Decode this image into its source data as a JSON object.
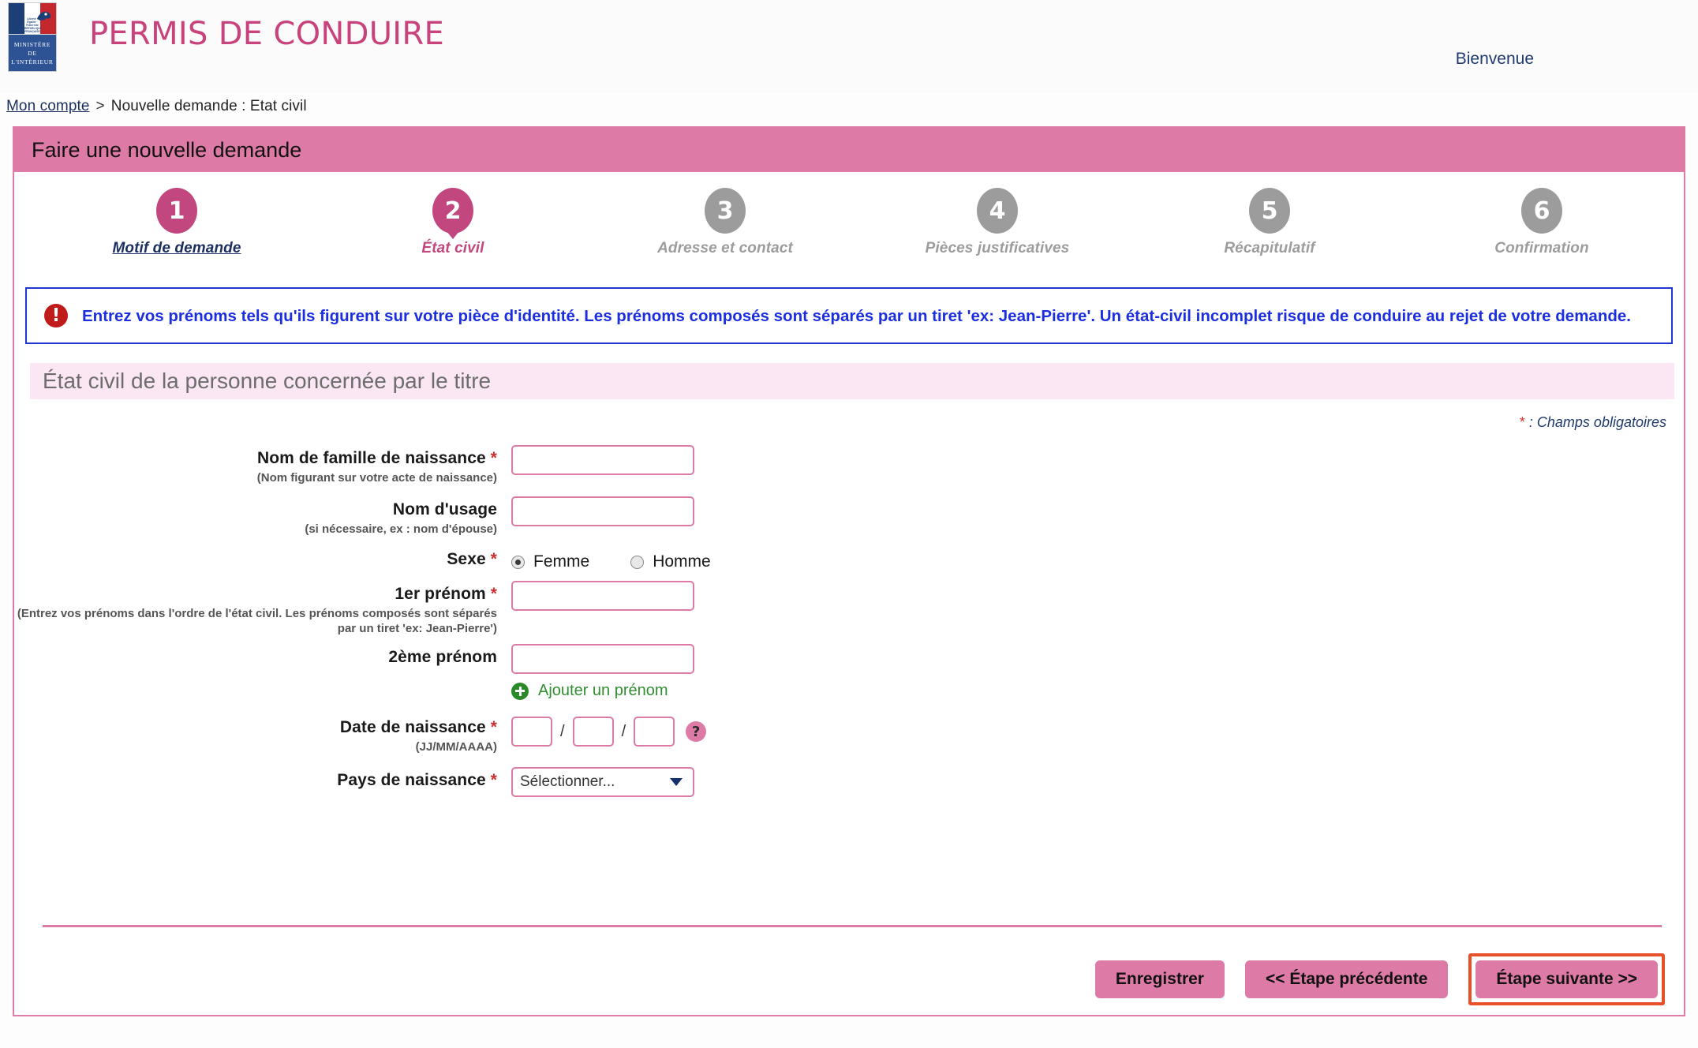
{
  "header": {
    "site_title": "PERMIS DE CONDUIRE",
    "welcome": "Bienvenue",
    "logo": {
      "devise": "Liberté · Égalité · Fraternité",
      "republique": "RÉPUBLIQUE FRANÇAISE",
      "ministry_line1": "MINISTÈRE",
      "ministry_line2": "DE",
      "ministry_line3": "L'INTÉRIEUR"
    }
  },
  "breadcrumb": {
    "home": "Mon compte",
    "separator": ">",
    "current": "Nouvelle demande : Etat civil"
  },
  "container": {
    "title": "Faire une nouvelle demande"
  },
  "stepper": {
    "steps": [
      {
        "number": "1",
        "label": "Motif de demande",
        "state": "done"
      },
      {
        "number": "2",
        "label": "État civil",
        "state": "current"
      },
      {
        "number": "3",
        "label": "Adresse et contact",
        "state": "todo"
      },
      {
        "number": "4",
        "label": "Pièces justificatives",
        "state": "todo"
      },
      {
        "number": "5",
        "label": "Récapitulatif",
        "state": "todo"
      },
      {
        "number": "6",
        "label": "Confirmation",
        "state": "todo"
      }
    ]
  },
  "alert": {
    "icon": "exclamation-icon",
    "text": "Entrez vos prénoms tels qu'ils figurent sur votre pièce d'identité. Les prénoms composés sont séparés par un tiret 'ex: Jean-Pierre'. Un état-civil incomplet risque de conduire au rejet de votre demande."
  },
  "section": {
    "heading": "État civil de la personne concernée par le titre",
    "required_note_star": "*",
    "required_note_text": " : Champs obligatoires"
  },
  "form": {
    "nom_naissance": {
      "label": "Nom de famille de naissance",
      "required_star": "*",
      "hint": "(Nom figurant sur votre acte de naissance)",
      "value": "",
      "placeholder": ""
    },
    "nom_usage": {
      "label": "Nom d'usage",
      "hint": "(si nécessaire, ex : nom d'épouse)",
      "value": "",
      "placeholder": ""
    },
    "sexe": {
      "label": "Sexe",
      "required_star": "*",
      "options": [
        {
          "label": "Femme",
          "selected": true
        },
        {
          "label": "Homme",
          "selected": false
        }
      ]
    },
    "prenom1": {
      "label": "1er prénom",
      "required_star": "*",
      "hint": "(Entrez vos prénoms dans l'ordre de l'état civil. Les prénoms composés sont séparés par un tiret 'ex: Jean-Pierre')",
      "value": "",
      "placeholder": ""
    },
    "prenom2": {
      "label": "2ème prénom",
      "value": "",
      "placeholder": ""
    },
    "add_prenom": {
      "label": "Ajouter un prénom",
      "icon": "plus-circle-icon"
    },
    "date_naissance": {
      "label": "Date de naissance",
      "required_star": "*",
      "hint": "(JJ/MM/AAAA)",
      "day": "",
      "month": "",
      "year": "",
      "separator": "/",
      "help_icon_label": "?"
    },
    "pays_naissance": {
      "label": "Pays de naissance",
      "required_star": "*",
      "selected": "Sélectionner..."
    }
  },
  "footer": {
    "save_label": "Enregistrer",
    "prev_label": "<<  Étape précédente",
    "next_label": "Étape suivante >>"
  },
  "colors": {
    "brand_pink": "#dd7aa5",
    "accent_magenta": "#c2477e",
    "title_pink": "#c8427c",
    "alert_blue": "#1c2fe0",
    "alert_red": "#c01a1a",
    "required_red": "#d03030",
    "green_link": "#2f8f2f",
    "highlight_orange": "#e8502a",
    "navy": "#1b2f5e",
    "inactive_gray": "#9c9c9c",
    "section_bg": "#fae7f3"
  }
}
